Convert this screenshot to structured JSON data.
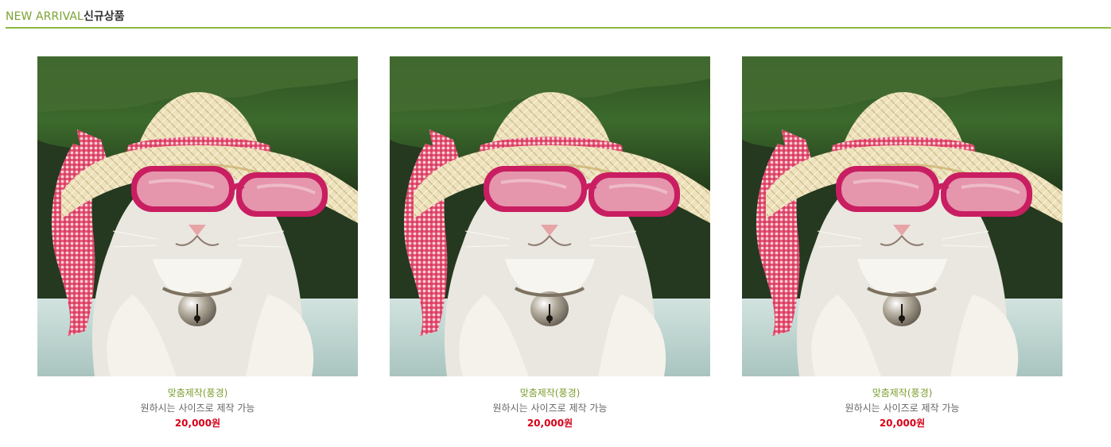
{
  "section": {
    "title_en": "NEW ARRIVAL",
    "title_ko": "신규상품",
    "accent_color": "#8db83f"
  },
  "products": [
    {
      "name": "맞춤제작(풍경)",
      "description": "원하시는 사이즈로 제작 가능",
      "price": "20,000원"
    },
    {
      "name": "맞춤제작(풍경)",
      "description": "원하시는 사이즈로 제작 가능",
      "price": "20,000원"
    },
    {
      "name": "맞춤제작(풍경)",
      "description": "원하시는 사이즈로 제작 가능",
      "price": "20,000원"
    }
  ]
}
